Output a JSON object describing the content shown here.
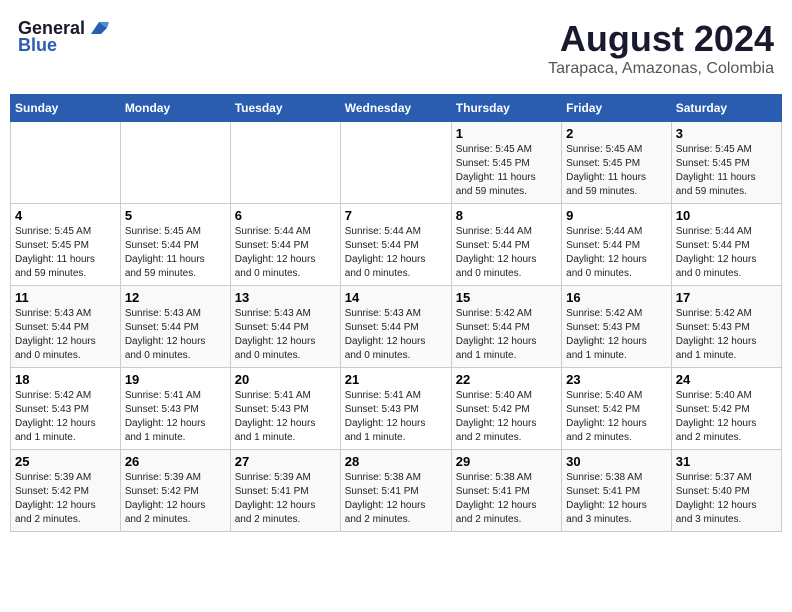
{
  "header": {
    "logo_general": "General",
    "logo_blue": "Blue",
    "title": "August 2024",
    "subtitle": "Tarapaca, Amazonas, Colombia"
  },
  "days_of_week": [
    "Sunday",
    "Monday",
    "Tuesday",
    "Wednesday",
    "Thursday",
    "Friday",
    "Saturday"
  ],
  "weeks": [
    [
      {
        "day": "",
        "detail": ""
      },
      {
        "day": "",
        "detail": ""
      },
      {
        "day": "",
        "detail": ""
      },
      {
        "day": "",
        "detail": ""
      },
      {
        "day": "1",
        "detail": "Sunrise: 5:45 AM\nSunset: 5:45 PM\nDaylight: 11 hours\nand 59 minutes."
      },
      {
        "day": "2",
        "detail": "Sunrise: 5:45 AM\nSunset: 5:45 PM\nDaylight: 11 hours\nand 59 minutes."
      },
      {
        "day": "3",
        "detail": "Sunrise: 5:45 AM\nSunset: 5:45 PM\nDaylight: 11 hours\nand 59 minutes."
      }
    ],
    [
      {
        "day": "4",
        "detail": "Sunrise: 5:45 AM\nSunset: 5:45 PM\nDaylight: 11 hours\nand 59 minutes."
      },
      {
        "day": "5",
        "detail": "Sunrise: 5:45 AM\nSunset: 5:44 PM\nDaylight: 11 hours\nand 59 minutes."
      },
      {
        "day": "6",
        "detail": "Sunrise: 5:44 AM\nSunset: 5:44 PM\nDaylight: 12 hours\nand 0 minutes."
      },
      {
        "day": "7",
        "detail": "Sunrise: 5:44 AM\nSunset: 5:44 PM\nDaylight: 12 hours\nand 0 minutes."
      },
      {
        "day": "8",
        "detail": "Sunrise: 5:44 AM\nSunset: 5:44 PM\nDaylight: 12 hours\nand 0 minutes."
      },
      {
        "day": "9",
        "detail": "Sunrise: 5:44 AM\nSunset: 5:44 PM\nDaylight: 12 hours\nand 0 minutes."
      },
      {
        "day": "10",
        "detail": "Sunrise: 5:44 AM\nSunset: 5:44 PM\nDaylight: 12 hours\nand 0 minutes."
      }
    ],
    [
      {
        "day": "11",
        "detail": "Sunrise: 5:43 AM\nSunset: 5:44 PM\nDaylight: 12 hours\nand 0 minutes."
      },
      {
        "day": "12",
        "detail": "Sunrise: 5:43 AM\nSunset: 5:44 PM\nDaylight: 12 hours\nand 0 minutes."
      },
      {
        "day": "13",
        "detail": "Sunrise: 5:43 AM\nSunset: 5:44 PM\nDaylight: 12 hours\nand 0 minutes."
      },
      {
        "day": "14",
        "detail": "Sunrise: 5:43 AM\nSunset: 5:44 PM\nDaylight: 12 hours\nand 0 minutes."
      },
      {
        "day": "15",
        "detail": "Sunrise: 5:42 AM\nSunset: 5:44 PM\nDaylight: 12 hours\nand 1 minute."
      },
      {
        "day": "16",
        "detail": "Sunrise: 5:42 AM\nSunset: 5:43 PM\nDaylight: 12 hours\nand 1 minute."
      },
      {
        "day": "17",
        "detail": "Sunrise: 5:42 AM\nSunset: 5:43 PM\nDaylight: 12 hours\nand 1 minute."
      }
    ],
    [
      {
        "day": "18",
        "detail": "Sunrise: 5:42 AM\nSunset: 5:43 PM\nDaylight: 12 hours\nand 1 minute."
      },
      {
        "day": "19",
        "detail": "Sunrise: 5:41 AM\nSunset: 5:43 PM\nDaylight: 12 hours\nand 1 minute."
      },
      {
        "day": "20",
        "detail": "Sunrise: 5:41 AM\nSunset: 5:43 PM\nDaylight: 12 hours\nand 1 minute."
      },
      {
        "day": "21",
        "detail": "Sunrise: 5:41 AM\nSunset: 5:43 PM\nDaylight: 12 hours\nand 1 minute."
      },
      {
        "day": "22",
        "detail": "Sunrise: 5:40 AM\nSunset: 5:42 PM\nDaylight: 12 hours\nand 2 minutes."
      },
      {
        "day": "23",
        "detail": "Sunrise: 5:40 AM\nSunset: 5:42 PM\nDaylight: 12 hours\nand 2 minutes."
      },
      {
        "day": "24",
        "detail": "Sunrise: 5:40 AM\nSunset: 5:42 PM\nDaylight: 12 hours\nand 2 minutes."
      }
    ],
    [
      {
        "day": "25",
        "detail": "Sunrise: 5:39 AM\nSunset: 5:42 PM\nDaylight: 12 hours\nand 2 minutes."
      },
      {
        "day": "26",
        "detail": "Sunrise: 5:39 AM\nSunset: 5:42 PM\nDaylight: 12 hours\nand 2 minutes."
      },
      {
        "day": "27",
        "detail": "Sunrise: 5:39 AM\nSunset: 5:41 PM\nDaylight: 12 hours\nand 2 minutes."
      },
      {
        "day": "28",
        "detail": "Sunrise: 5:38 AM\nSunset: 5:41 PM\nDaylight: 12 hours\nand 2 minutes."
      },
      {
        "day": "29",
        "detail": "Sunrise: 5:38 AM\nSunset: 5:41 PM\nDaylight: 12 hours\nand 2 minutes."
      },
      {
        "day": "30",
        "detail": "Sunrise: 5:38 AM\nSunset: 5:41 PM\nDaylight: 12 hours\nand 3 minutes."
      },
      {
        "day": "31",
        "detail": "Sunrise: 5:37 AM\nSunset: 5:40 PM\nDaylight: 12 hours\nand 3 minutes."
      }
    ]
  ]
}
